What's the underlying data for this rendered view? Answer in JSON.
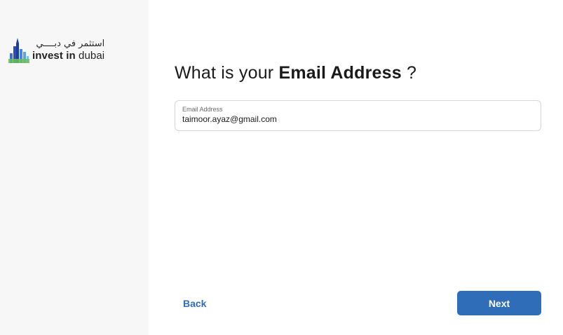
{
  "logo": {
    "arabic": "استثمر في دبــــي",
    "english_bold": "invest in",
    "english_light": "dubai"
  },
  "question": {
    "prefix": "What is your ",
    "emphasis": "Email Address",
    "suffix": " ?"
  },
  "email_field": {
    "label": "Email Address",
    "value": "taimoor.ayaz@gmail.com"
  },
  "actions": {
    "back_label": "Back",
    "next_label": "Next"
  },
  "colors": {
    "accent": "#2f6db8",
    "sidebar_bg": "#f7f7f7"
  }
}
